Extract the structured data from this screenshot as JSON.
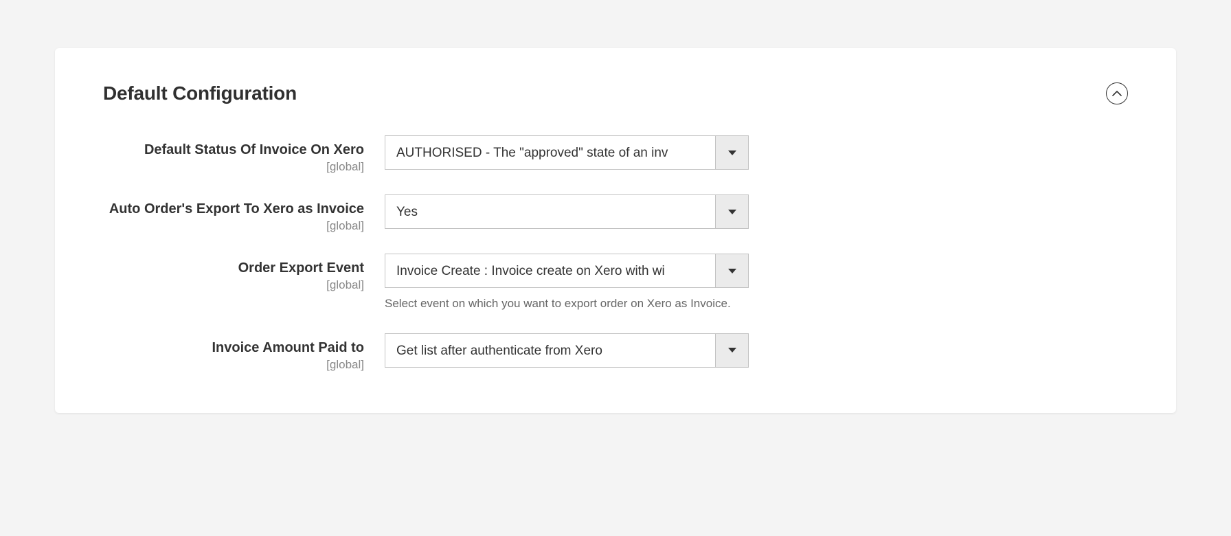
{
  "section": {
    "title": "Default Configuration"
  },
  "fields": {
    "default_status": {
      "label": "Default Status Of Invoice On Xero",
      "scope": "[global]",
      "value": "AUTHORISED - The \"approved\" state of an inv"
    },
    "auto_export": {
      "label": "Auto Order's Export To Xero as Invoice",
      "scope": "[global]",
      "value": "Yes"
    },
    "export_event": {
      "label": "Order Export Event",
      "scope": "[global]",
      "value": "Invoice Create : Invoice create on Xero with wi",
      "hint": "Select event on which you want to export order on Xero as Invoice."
    },
    "amount_paid_to": {
      "label": "Invoice Amount Paid to",
      "scope": "[global]",
      "value": "Get list after authenticate from Xero"
    }
  }
}
